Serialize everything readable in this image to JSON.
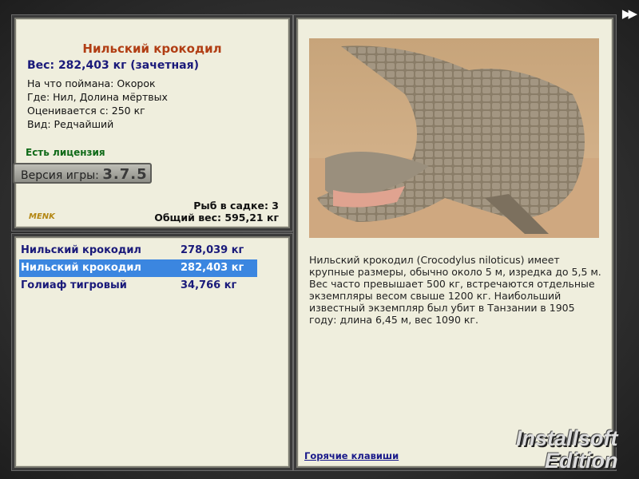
{
  "info": {
    "title": "Нильский крокодил",
    "weight": "Вес: 282,403 кг (зачетная)",
    "caught_on": "На что поймана: Окорок",
    "where": "Где: Нил, Долина мёртвых",
    "valued_from": "Оценивается с: 250 кг",
    "kind": "Вид: Редчайший",
    "license": "Есть лицензия",
    "version_label": "Версия игры:",
    "version_num": "3.7.5",
    "logo_text": "MENK",
    "fish_in_keepnet": "Рыб в садке: 3",
    "total_weight": "Общий вес: 595,21 кг"
  },
  "catch_list": [
    {
      "name": "Нильский крокодил",
      "weight": "278,039 кг",
      "selected": false
    },
    {
      "name": "Нильский крокодил",
      "weight": "282,403 кг",
      "selected": true
    },
    {
      "name": "Голиаф тигровый",
      "weight": "34,766 кг",
      "selected": false
    }
  ],
  "description": {
    "text": "Нильский крокодил (Crocodylus niloticus) имеет крупные размеры, обычно около 5 м, изредка до 5,5 м. Вес часто превышает 500 кг, встречаются отдельные экземпляры весом свыше 1200 кг. Наибольший известный экземпляр был убит в Танзании в 1905 году: длина 6,45 м, вес 1090 кг.",
    "hotkeys": "Горячие клавиши"
  },
  "watermark": {
    "line1": "Installsoft",
    "line2": "Edition"
  },
  "nav": {
    "forward_icon": "fast-forward-icon"
  },
  "colors": {
    "title": "#b13e14",
    "selected_row": "#3b86e0",
    "list_text": "#1a1a7a",
    "license": "#0f6a18"
  }
}
